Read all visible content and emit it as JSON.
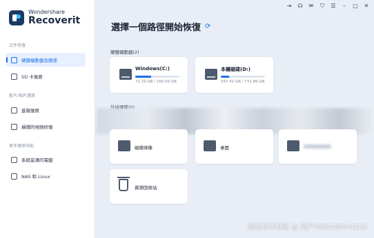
{
  "app": {
    "brand": "Wondershare",
    "product": "Recoverit"
  },
  "window_controls": [
    "sign-in-icon",
    "headset-icon",
    "mail-icon",
    "shield-icon",
    "menu-icon",
    "minimize-icon",
    "maximize-icon",
    "close-icon"
  ],
  "sidebar": {
    "sections": [
      {
        "title": "文件恢復",
        "items": [
          {
            "label": "硬盤驅動器及路徑",
            "icon": "harddisk-icon",
            "active": true
          },
          {
            "label": "SD 卡復原",
            "icon": "sdcard-icon",
            "active": false
          }
        ]
      },
      {
        "title": "影片/相片還原",
        "items": [
          {
            "label": "進階復原",
            "icon": "advanced-recovery-icon",
            "active": false
          },
          {
            "label": "損壞的視頻修復",
            "icon": "video-repair-icon",
            "active": false
          }
        ]
      },
      {
        "title": "更多復原功能",
        "items": [
          {
            "label": "系統崩潰的電腦",
            "icon": "computer-icon",
            "active": false
          },
          {
            "label": "NAS 和 Linux",
            "icon": "nas-icon",
            "active": false
          }
        ]
      }
    ]
  },
  "main": {
    "title": "選擇一個路徑開始恢復",
    "hard_drives": {
      "label": "硬盤驅動器(2)",
      "drives": [
        {
          "name": "Windows(C:)",
          "size": "72.29 GB / 200.00 GB",
          "used_fraction": 0.36
        },
        {
          "name": "本機磁碟(D:)",
          "size": "597.42 GB / 731.86 GB",
          "used_fraction": 0.18
        }
      ]
    },
    "external_label": "外接硬碟(0)",
    "actions": [
      {
        "label": "磁碟映像",
        "icon": "disk-image-icon"
      },
      {
        "label": "桌面",
        "icon": "desktop-icon"
      },
      {
        "label": "",
        "icon": "folder-icon"
      },
      {
        "label": "資源回收站",
        "icon": "recycle-bin-icon"
      }
    ]
  },
  "watermark": "掘金技术社区 @ 用户498248544526",
  "colors": {
    "accent": "#1f6fe8",
    "sidebar_active_bg": "#e6f0ff",
    "main_bg": "#e9eef6"
  }
}
